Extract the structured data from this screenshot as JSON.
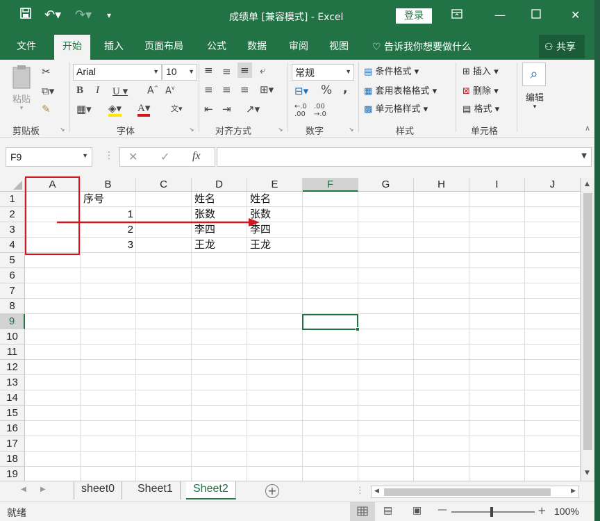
{
  "window": {
    "title": "成绩单  [兼容模式]  -  Excel",
    "login_label": "登录"
  },
  "tabs": {
    "file": "文件",
    "home": "开始",
    "insert": "插入",
    "layout": "页面布局",
    "formulas": "公式",
    "data": "数据",
    "review": "审阅",
    "view": "视图",
    "tellme": "告诉我你想要做什么",
    "share": "共享"
  },
  "ribbon": {
    "clipboard": {
      "label": "剪贴板",
      "paste": "粘贴"
    },
    "font": {
      "label": "字体",
      "name": "Arial",
      "size": "10"
    },
    "alignment": {
      "label": "对齐方式"
    },
    "number": {
      "label": "数字",
      "format": "常规",
      "percent": "%",
      "comma": ","
    },
    "styles": {
      "label": "样式",
      "conditional": "条件格式",
      "as_table": "套用表格格式",
      "cell_styles": "单元格样式"
    },
    "cells": {
      "label": "单元格",
      "insert": "插入",
      "delete": "删除",
      "format": "格式"
    },
    "editing": {
      "label": "编辑"
    }
  },
  "formula_bar": {
    "name_box": "F9",
    "fx": "fx",
    "formula": ""
  },
  "columns": [
    "A",
    "B",
    "C",
    "D",
    "E",
    "F",
    "G",
    "H",
    "I",
    "J"
  ],
  "rows": [
    "1",
    "2",
    "3",
    "4",
    "5",
    "6",
    "7",
    "8",
    "9",
    "10",
    "11",
    "12",
    "13",
    "14",
    "15",
    "16",
    "17",
    "18",
    "19"
  ],
  "cells": {
    "B1": "序号",
    "B2": "1",
    "B3": "2",
    "B4": "3",
    "D1": "姓名",
    "D2": "张数",
    "D3": "李四",
    "D4": "王龙",
    "E1": "姓名",
    "E2": "张数",
    "E3": "李四",
    "E4": "王龙"
  },
  "selected": {
    "column": "F",
    "row": "9"
  },
  "sheets": [
    "sheet0",
    "Sheet1",
    "Sheet2"
  ],
  "active_sheet": "Sheet2",
  "status": {
    "text": "就绪",
    "zoom": "100%"
  },
  "colors": {
    "accent": "#217346",
    "annotation": "#d0161e"
  }
}
